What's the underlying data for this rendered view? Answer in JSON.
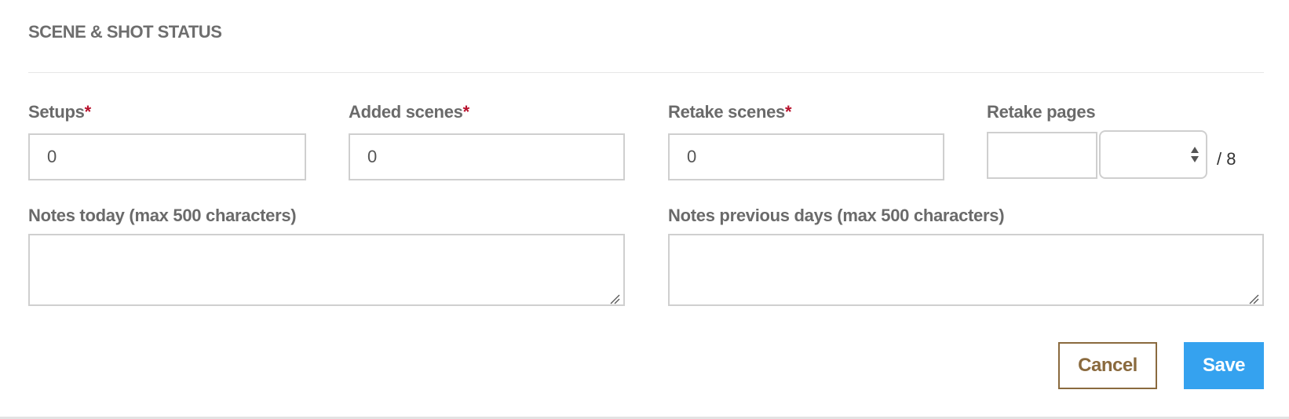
{
  "section": {
    "title": "SCENE & SHOT STATUS"
  },
  "fields": {
    "setups": {
      "label": "Setups",
      "required_mark": "*",
      "value": "0"
    },
    "added_scenes": {
      "label": "Added scenes",
      "required_mark": "*",
      "value": "0"
    },
    "retake_scenes": {
      "label": "Retake scenes",
      "required_mark": "*",
      "value": "0"
    },
    "retake_pages": {
      "label": "Retake pages",
      "whole_value": "",
      "eighths_value": "",
      "fraction_suffix": "/ 8"
    },
    "notes_today": {
      "label": "Notes today (max 500 characters)",
      "value": ""
    },
    "notes_previous": {
      "label": "Notes previous days (max 500 characters)",
      "value": ""
    }
  },
  "actions": {
    "cancel_label": "Cancel",
    "save_label": "Save"
  },
  "colors": {
    "required": "#b8112c",
    "cancel_border": "#8a6a3e",
    "save_background": "#35a2ef"
  },
  "icons": {
    "stepper": "up-down-arrows-icon",
    "resize": "resize-grip-icon"
  }
}
